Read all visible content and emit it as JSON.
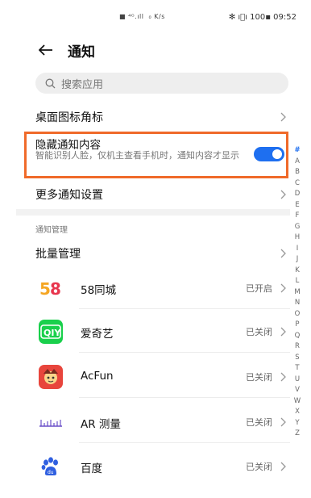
{
  "statusbar": {
    "center": "■ ⁴ᴳ.ıll  ₀⁄ₖ/s",
    "right": "✶ ı⃝ı ⎕ · 09:52"
  },
  "header": {
    "title": "通知"
  },
  "search": {
    "placeholder": "搜索应用"
  },
  "settings": {
    "badge_label": "桌面图标角标",
    "hidden_title": "隐藏通知内容",
    "hidden_desc": "智能识别人脸，仅机主查看手机时，通知内容才显示",
    "hidden_toggle_on": true,
    "more_label": "更多通知设置"
  },
  "section": {
    "label": "通知管理"
  },
  "batch": {
    "label": "批量管理"
  },
  "apps": [
    {
      "name": "58同城",
      "status": "已开启",
      "icon": "58-logo-icon"
    },
    {
      "name": "爱奇艺",
      "status": "已关闭",
      "icon": "iqiyi-logo-icon"
    },
    {
      "name": "AcFun",
      "status": "已关闭",
      "icon": "acfun-logo-icon"
    },
    {
      "name": "AR 测量",
      "status": "已关闭",
      "icon": "ar-measure-icon"
    },
    {
      "name": "百度",
      "status": "已关闭",
      "icon": "baidu-paw-icon"
    }
  ],
  "alphabet": [
    "#",
    "A",
    "B",
    "C",
    "D",
    "E",
    "F",
    "G",
    "H",
    "I",
    "J",
    "K",
    "L",
    "M",
    "N",
    "O",
    "P",
    "Q",
    "R",
    "S",
    "T",
    "U",
    "V",
    "W",
    "X",
    "Y",
    "Z"
  ],
  "colors": {
    "accent": "#1e6ff0",
    "highlight": "#f06a2a"
  }
}
